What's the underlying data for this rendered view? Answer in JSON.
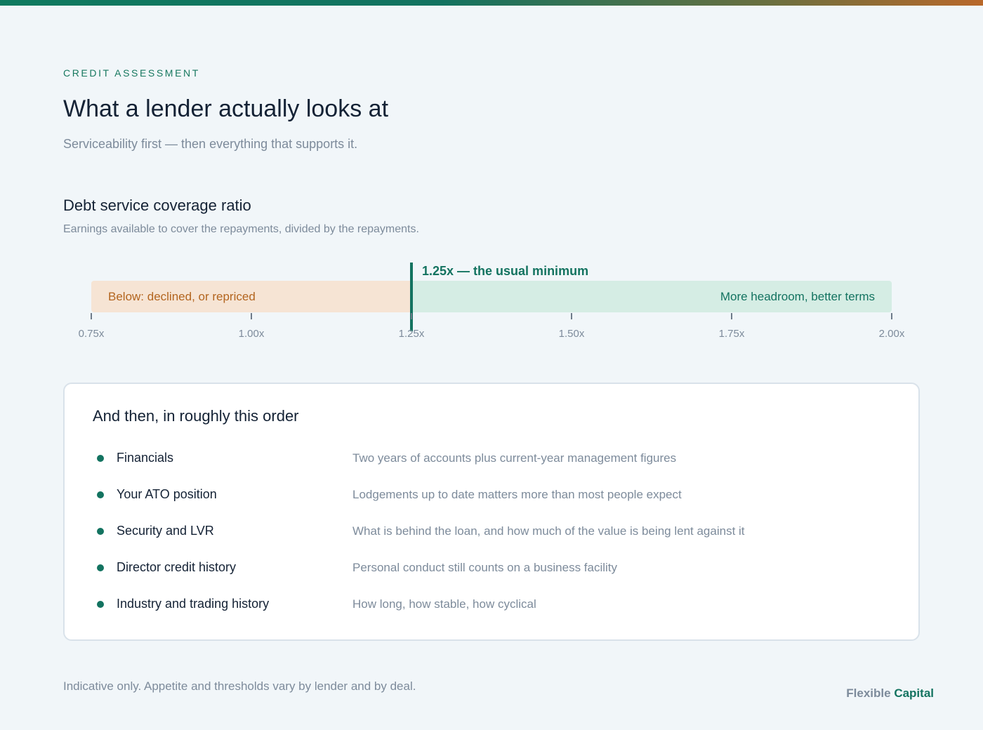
{
  "header": {
    "eyebrow": "CREDIT ASSESSMENT",
    "title": "What a lender actually looks at",
    "subtitle": "Serviceability first — then everything that supports it."
  },
  "dscr": {
    "title": "Debt service coverage ratio",
    "description": "Earnings available to cover the repayments, divided by the repayments.",
    "scale_min": 0.75,
    "scale_max": 2.0,
    "threshold": 1.25,
    "threshold_label": "1.25x — the usual minimum",
    "below_label": "Below: declined, or repriced",
    "above_label": "More headroom, better terms",
    "ticks": [
      "0.75x",
      "1.00x",
      "1.25x",
      "1.50x",
      "1.75x",
      "2.00x"
    ],
    "colors": {
      "below": "#f6e4d4",
      "above": "#d5ede4",
      "accent": "#137360",
      "warning": "#b3651f"
    }
  },
  "factors": {
    "title": "And then, in roughly this order",
    "items": [
      {
        "name": "Financials",
        "desc": "Two years of accounts plus current-year management figures"
      },
      {
        "name": "Your ATO position",
        "desc": "Lodgements up to date matters more than most people expect"
      },
      {
        "name": "Security and LVR",
        "desc": "What is behind the loan, and how much of the value is being lent against it"
      },
      {
        "name": "Director credit history",
        "desc": "Personal conduct still counts on a business facility"
      },
      {
        "name": "Industry and trading history",
        "desc": "How long, how stable, how cyclical"
      }
    ]
  },
  "footer": {
    "note": "Indicative only. Appetite and thresholds vary by lender and by deal.",
    "brand_part1": "Flexible",
    "brand_part2": "Capital"
  }
}
